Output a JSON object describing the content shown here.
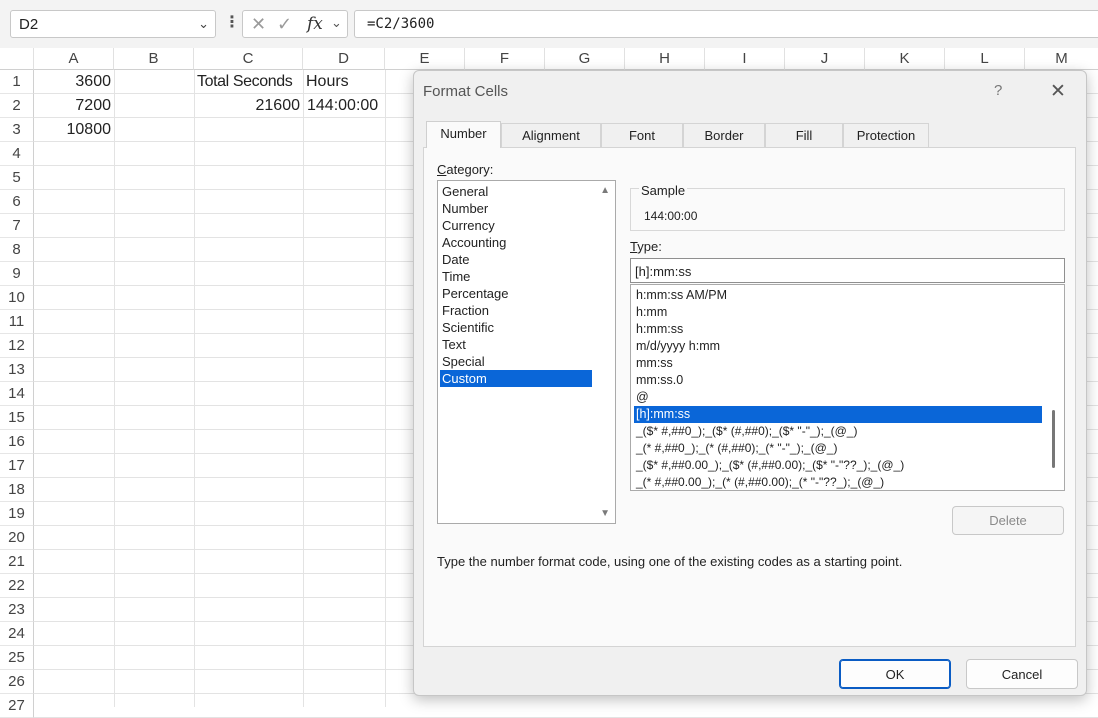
{
  "formula_bar": {
    "name_box": "D2",
    "formula": "=C2/3600",
    "fx_label": "fx"
  },
  "sheet": {
    "columns": [
      "A",
      "B",
      "C",
      "D",
      "E",
      "F",
      "G",
      "H",
      "I",
      "J",
      "K",
      "L",
      "M"
    ],
    "rows": [
      "1",
      "2",
      "3",
      "4",
      "5",
      "6",
      "7",
      "8",
      "9",
      "10",
      "11",
      "12",
      "13",
      "14",
      "15",
      "16",
      "17",
      "18",
      "19",
      "20",
      "21",
      "22",
      "23",
      "24",
      "25",
      "26",
      "27"
    ],
    "cells": {
      "A1": "3600",
      "A2": "7200",
      "A3": "10800",
      "C1": "Total Seconds",
      "D1": "Hours",
      "C2": "21600",
      "D2": "144:00:00"
    }
  },
  "dialog": {
    "title": "Format Cells",
    "help": "?",
    "tabs": [
      "Number",
      "Alignment",
      "Font",
      "Border",
      "Fill",
      "Protection"
    ],
    "active_tab": "Number",
    "category_label": "Category:",
    "categories": [
      "General",
      "Number",
      "Currency",
      "Accounting",
      "Date",
      "Time",
      "Percentage",
      "Fraction",
      "Scientific",
      "Text",
      "Special",
      "Custom"
    ],
    "selected_category": "Custom",
    "sample_label": "Sample",
    "sample_value": "144:00:00",
    "type_label": "Type:",
    "type_value": "[h]:mm:ss",
    "type_list": [
      "h:mm:ss AM/PM",
      "h:mm",
      "h:mm:ss",
      "m/d/yyyy h:mm",
      "mm:ss",
      "mm:ss.0",
      "@",
      "[h]:mm:ss",
      "_($* #,##0_);_($* (#,##0);_($* \"-\"_);_(@_)",
      "_(* #,##0_);_(* (#,##0);_(* \"-\"_);_(@_)",
      "_($* #,##0.00_);_($* (#,##0.00);_($* \"-\"??_);_(@_)",
      "_(* #,##0.00_);_(* (#,##0.00);_(* \"-\"??_);_(@_)"
    ],
    "selected_type": "[h]:mm:ss",
    "delete_label": "Delete",
    "hint": "Type the number format code, using one of the existing codes as a starting point.",
    "ok_label": "OK",
    "cancel_label": "Cancel"
  }
}
